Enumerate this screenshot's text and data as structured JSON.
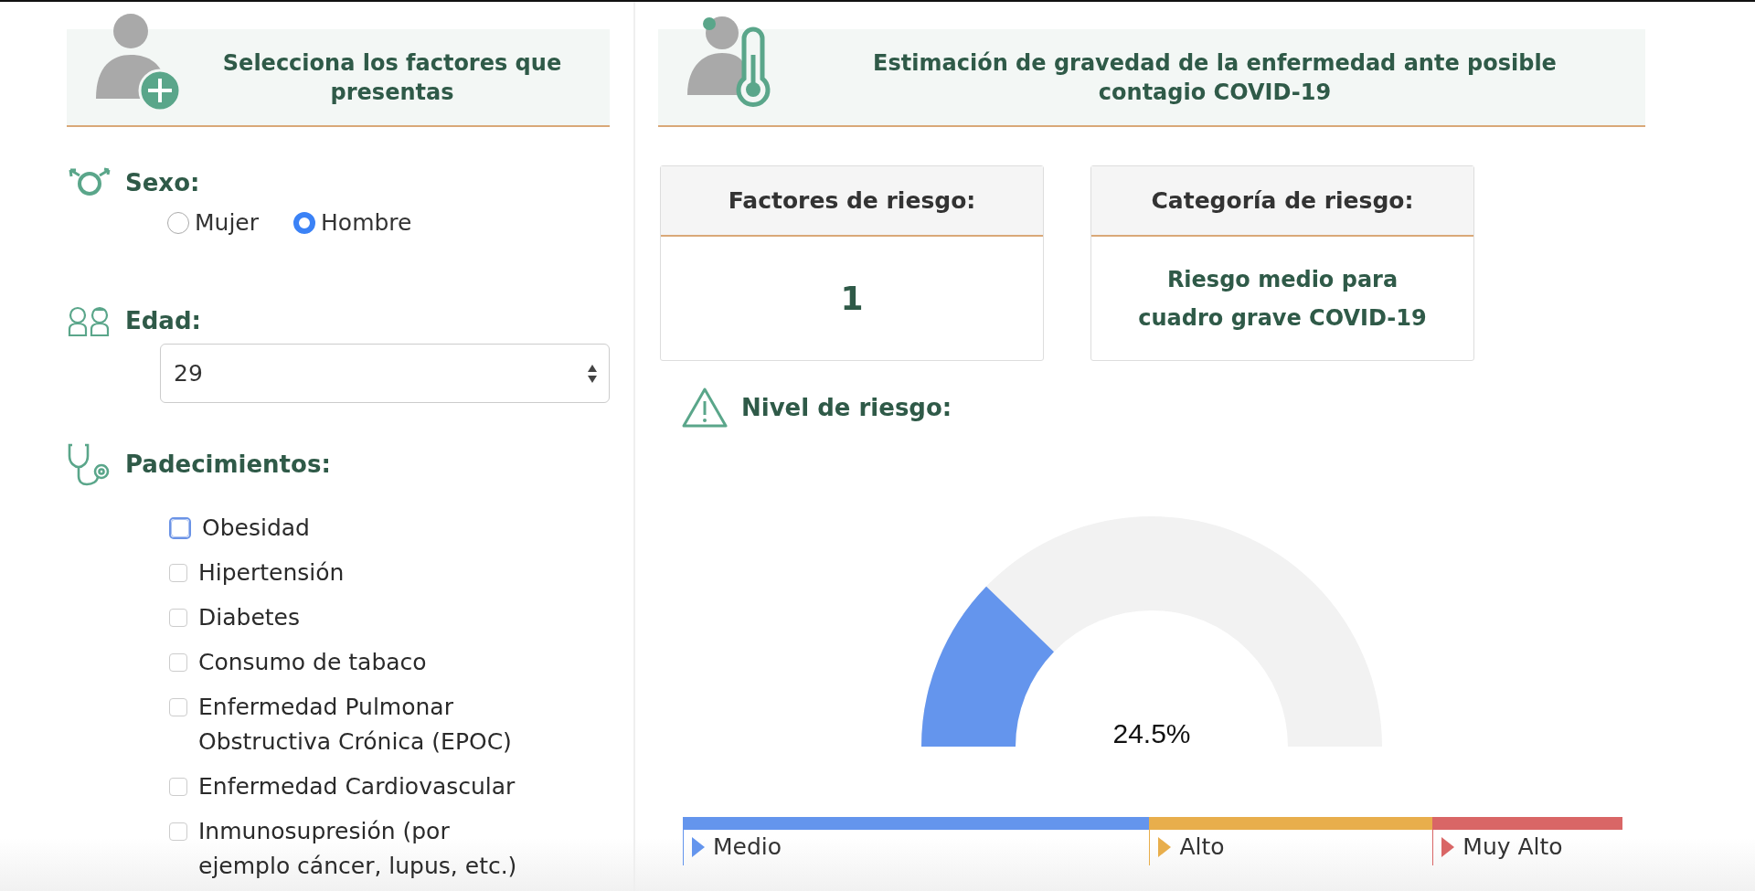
{
  "left_panel": {
    "title": "Selecciona los factores que presentas"
  },
  "sex": {
    "label": "Sexo:",
    "options": [
      {
        "label": "Mujer",
        "selected": false
      },
      {
        "label": "Hombre",
        "selected": true
      }
    ]
  },
  "age": {
    "label": "Edad:",
    "value": "29"
  },
  "conditions": {
    "label": "Padecimientos:",
    "items": [
      {
        "label": "Obesidad",
        "checked": false,
        "focused": true
      },
      {
        "label": "Hipertensión",
        "checked": false,
        "focused": false
      },
      {
        "label": "Diabetes",
        "checked": false,
        "focused": false
      },
      {
        "label": "Consumo de tabaco",
        "checked": false,
        "focused": false
      },
      {
        "label": "Enfermedad Pulmonar Obstructiva Crónica (EPOC)",
        "checked": false,
        "focused": false
      },
      {
        "label": "Enfermedad Cardiovascular",
        "checked": false,
        "focused": false
      },
      {
        "label": "Inmunosupresión (por ejemplo cáncer, lupus, etc.)",
        "checked": false,
        "focused": false
      }
    ]
  },
  "right_panel": {
    "title": "Estimación de gravedad de la enfermedad ante posible contagio COVID-19"
  },
  "cards": [
    {
      "title": "Factores de riesgo:",
      "value": "1",
      "kind": "number"
    },
    {
      "title": "Categoría de riesgo:",
      "value": "Riesgo medio para cuadro grave COVID-19",
      "kind": "text"
    }
  ],
  "risk_level": {
    "label": "Nivel de riesgo:",
    "level": 0.245,
    "reading": "24.5%"
  },
  "legend": [
    {
      "label": "Medio",
      "color": "#6495ed"
    },
    {
      "label": "Alto",
      "color": "#e8ae4c"
    },
    {
      "label": "Muy Alto",
      "color": "#d96666"
    }
  ]
}
